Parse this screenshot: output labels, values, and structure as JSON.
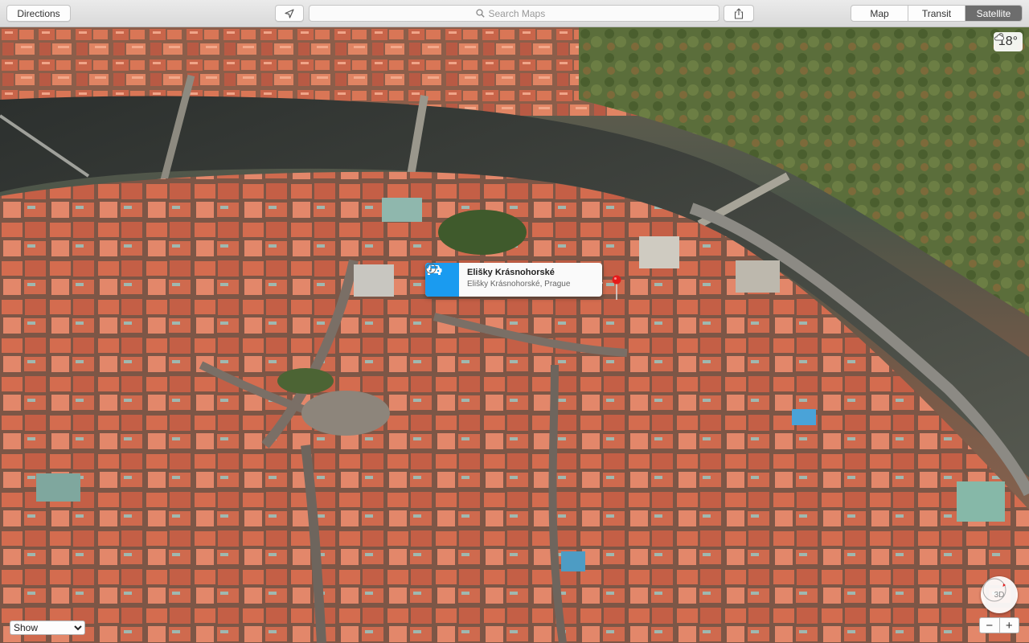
{
  "toolbar": {
    "directions_label": "Directions",
    "locate_icon": "location-arrow-icon",
    "search_placeholder": "Search Maps",
    "share_icon": "share-icon",
    "modes": [
      {
        "label": "Map",
        "active": false
      },
      {
        "label": "Transit",
        "active": false
      },
      {
        "label": "Satellite",
        "active": true
      }
    ]
  },
  "weather": {
    "icon": "cloud-sun-icon",
    "temperature": "18°"
  },
  "callout": {
    "icon": "car-icon",
    "title": "Elišky Krásnohorské",
    "subtitle": "Elišky Krásnohorské, Prague",
    "accent": "#1a9bf0",
    "info_icon": "info-icon"
  },
  "pin": {
    "icon": "map-pin-icon",
    "color": "#e51b1b"
  },
  "bottom": {
    "show_label": "Show",
    "compass_label": "3D",
    "zoom_out": "−",
    "zoom_in": "+"
  }
}
